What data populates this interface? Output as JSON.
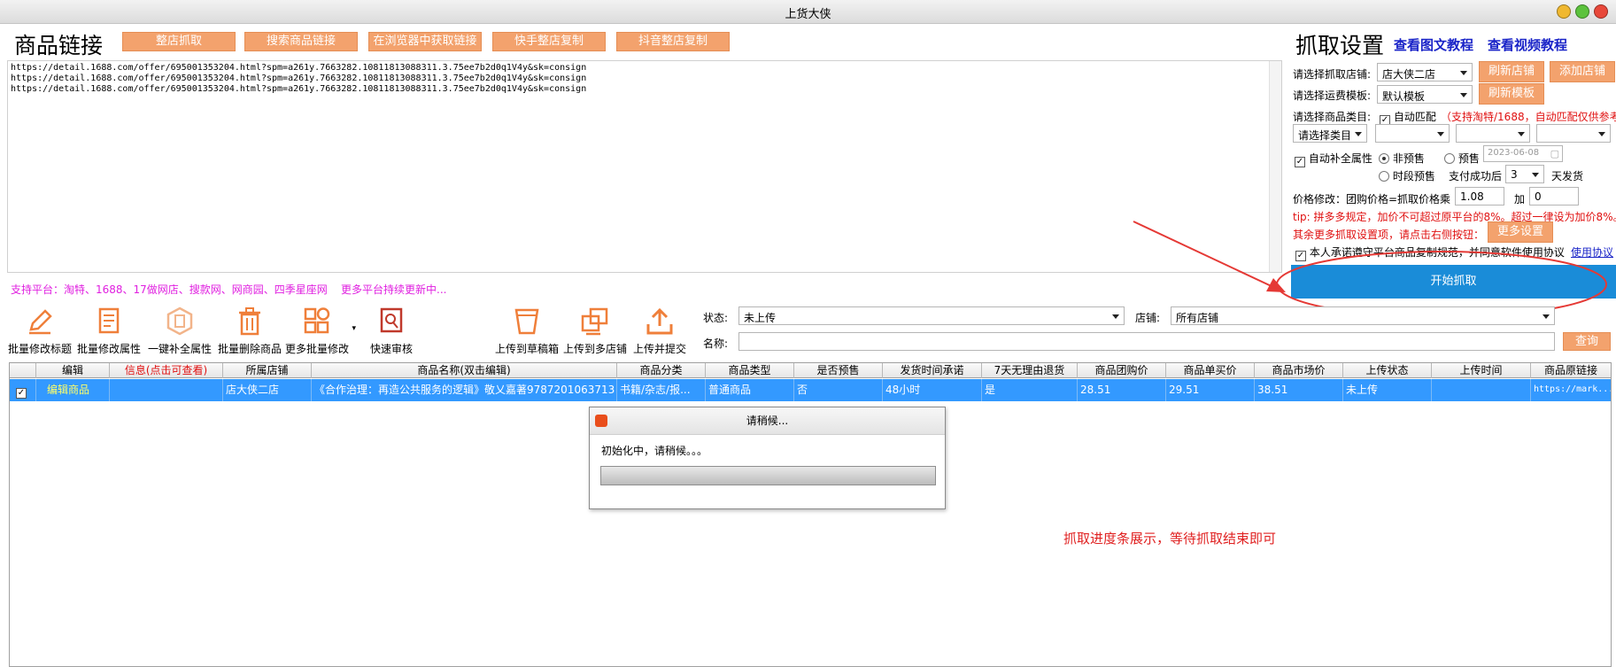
{
  "window": {
    "title": "上货大侠"
  },
  "link_section": {
    "heading": "商品链接",
    "buttons": [
      "整店抓取",
      "搜索商品链接",
      "在浏览器中获取链接",
      "快手整店复制",
      "抖音整店复制"
    ],
    "urls": [
      "https://detail.1688.com/offer/695001353204.html?spm=a261y.7663282.10811813088311.3.75ee7b2d0q1V4y&sk=consign",
      "https://detail.1688.com/offer/695001353204.html?spm=a261y.7663282.10811813088311.3.75ee7b2d0q1V4y&sk=consign",
      "https://detail.1688.com/offer/695001353204.html?spm=a261y.7663282.10811813088311.3.75ee7b2d0q1V4y&sk=consign"
    ],
    "support_text": "支持平台：淘特、1688、17做网店、搜款网、网商园、四季星座网",
    "more_text": "更多平台持续更新中..."
  },
  "settings": {
    "heading": "抓取设置",
    "link_image_tutorial": "查看图文教程",
    "link_video_tutorial": "查看视频教程",
    "shop_label": "请选择抓取店铺:",
    "shop_value": "店大侠二店",
    "refresh_shop": "刷新店铺",
    "add_shop": "添加店铺",
    "freight_label": "请选择运费模板:",
    "freight_value": "默认模板",
    "refresh_template": "刷新模板",
    "category_label": "请选择商品类目:",
    "auto_match": "自动匹配",
    "auto_match_note": "（支持淘特/1688，自动匹配仅供参考",
    "category_select": "请选择类目",
    "auto_attr": "自动补全属性",
    "non_presale": "非预售",
    "presale": "预售",
    "presale_date": "2023-06-08",
    "period_presale": "时段预售",
    "ship_after_pay": "支付成功后",
    "ship_days": "3",
    "ship_unit": "天发货",
    "price_label": "价格修改：团购价格=抓取价格乘",
    "price_multiplier": "1.08",
    "price_plus_label": "加",
    "price_plus": "0",
    "tip": "tip: 拼多多规定，加价不可超过原平台的8%。超过一律设为加价8%。",
    "more_settings_text": "其余更多抓取设置项，请点击右侧按钮：",
    "more_settings_btn": "更多设置",
    "agree_text": "本人承诺遵守平台商品复制规范，并同意软件使用协议",
    "agree_link": "使用协议",
    "start_btn": "开始抓取"
  },
  "toolbar": {
    "tools": [
      {
        "label": "批量修改标题",
        "icon": "pencil-icon"
      },
      {
        "label": "批量修改属性",
        "icon": "document-edit-icon"
      },
      {
        "label": "一键补全属性",
        "icon": "hexagon-doc-icon"
      },
      {
        "label": "批量删除商品",
        "icon": "trash-icon"
      },
      {
        "label": "更多批量修改",
        "icon": "grid-icon"
      },
      {
        "label": "快速审核",
        "icon": "review-icon"
      },
      {
        "label": "上传到草稿箱",
        "icon": "draft-bin-icon"
      },
      {
        "label": "上传到多店铺",
        "icon": "multi-shop-icon"
      },
      {
        "label": "上传并提交",
        "icon": "upload-icon"
      }
    ],
    "status_label": "状态:",
    "status_value": "未上传",
    "shop_label": "店铺:",
    "shop_value": "所有店铺",
    "name_label": "名称:",
    "name_value": "",
    "query_btn": "查询"
  },
  "table": {
    "headers": [
      "编辑",
      "信息(点击可查看)",
      "所属店铺",
      "商品名称(双击编辑)",
      "商品分类",
      "商品类型",
      "是否预售",
      "发货时间承诺",
      "7天无理由退货",
      "商品团购价",
      "商品单买价",
      "商品市场价",
      "上传状态",
      "上传时间",
      "商品原链接"
    ],
    "rows": [
      {
        "checked": "✓",
        "edit": "编辑商品",
        "info": "",
        "shop": "店大侠二店",
        "name": "《合作治理：再造公共服务的逻辑》敬乂嘉著9787201063713",
        "category": "书籍/杂志/报...",
        "type": "普通商品",
        "presale": "否",
        "ship_time": "48小时",
        "return7": "是",
        "group_price": "28.51",
        "single_price": "29.51",
        "market_price": "38.51",
        "upload_status": "未上传",
        "upload_time": "",
        "orig_link": "https://mark..."
      }
    ]
  },
  "dialog": {
    "title": "请稍候...",
    "message": "初始化中，请稍候。。。",
    "progress": 0
  },
  "annotation": {
    "note": "抓取进度条展示，等待抓取结束即可"
  },
  "colors": {
    "accent_orange": "#f3a26d",
    "start_blue": "#1a8cd8",
    "row_select": "#3399ff",
    "annotation_red": "#e53935"
  }
}
